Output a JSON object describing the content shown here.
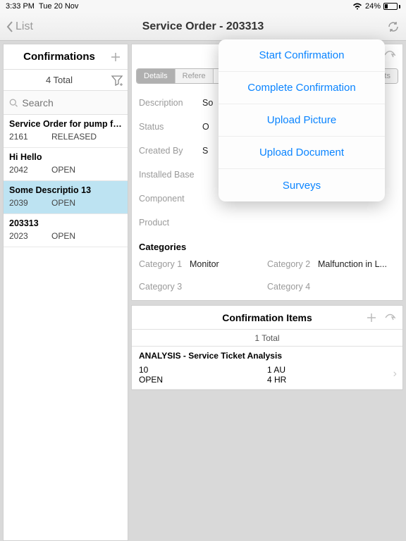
{
  "statusbar": {
    "time": "3:33 PM",
    "date": "Tue 20 Nov",
    "battery": "24%"
  },
  "nav": {
    "back": "List",
    "title": "Service Order - 203313"
  },
  "sidebar": {
    "title": "Confirmations",
    "count": "4 Total",
    "search_placeholder": "Search",
    "items": [
      {
        "title": "Service Order for pump fix FO...",
        "id": "2161",
        "status": "RELEASED"
      },
      {
        "title": "Hi Hello",
        "id": "2042",
        "status": "OPEN"
      },
      {
        "title": "Some Descriptio 13",
        "id": "2039",
        "status": "OPEN"
      },
      {
        "title": "203313",
        "id": "2023",
        "status": "OPEN"
      }
    ]
  },
  "tabs": {
    "details": "Details",
    "references": "Refere",
    "attachments": "achments"
  },
  "detail": {
    "description_label": "Description",
    "description_val": "So",
    "status_label": "Status",
    "status_val": "O",
    "createdby_label": "Created By",
    "createdby_val": "S",
    "installed_label": "Installed Base",
    "component_label": "Component",
    "product_label": "Product",
    "categories_label": "Categories",
    "cat1_label": "Category 1",
    "cat1_val": "Monitor",
    "cat2_label": "Category 2",
    "cat2_val": "Malfunction in L...",
    "cat3_label": "Category 3",
    "cat3_val": "",
    "cat4_label": "Category 4",
    "cat4_val": ""
  },
  "items": {
    "title": "Confirmation Items",
    "total": "1 Total",
    "row": {
      "title": "ANALYSIS - Service Ticket Analysis",
      "left1": "10",
      "right1": "1 AU",
      "left2": "OPEN",
      "right2": "4 HR"
    }
  },
  "popover": {
    "items": [
      "Start Confirmation",
      "Complete Confirmation",
      "Upload Picture",
      "Upload Document",
      "Surveys"
    ]
  }
}
